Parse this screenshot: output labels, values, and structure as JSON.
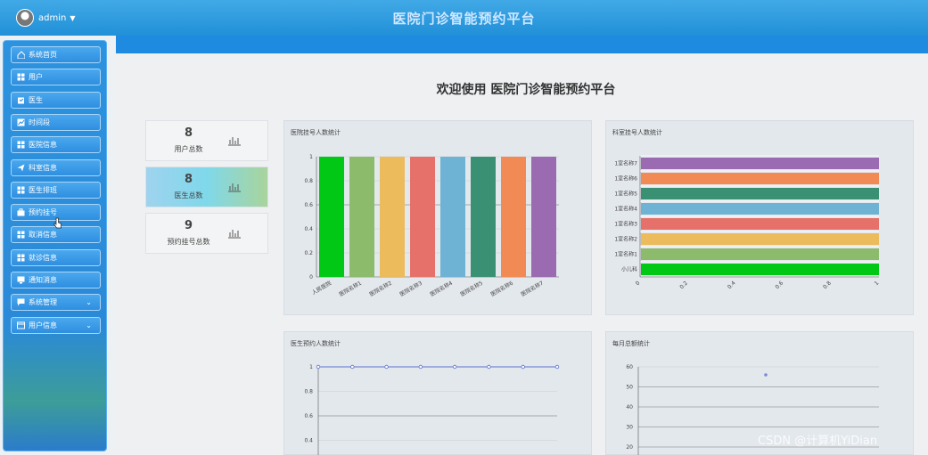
{
  "header": {
    "user": "admin",
    "title": "医院门诊智能预约平台"
  },
  "sidebar": {
    "items": [
      {
        "label": "系统首页",
        "icon": "home-icon"
      },
      {
        "label": "用户",
        "icon": "grid-icon"
      },
      {
        "label": "医生",
        "icon": "clipboard-icon"
      },
      {
        "label": "时间段",
        "icon": "chart-icon"
      },
      {
        "label": "医院信息",
        "icon": "grid-icon"
      },
      {
        "label": "科室信息",
        "icon": "send-icon"
      },
      {
        "label": "医生排班",
        "icon": "grid-icon"
      },
      {
        "label": "预约挂号",
        "icon": "briefcase-icon"
      },
      {
        "label": "取消信息",
        "icon": "grid-icon"
      },
      {
        "label": "就诊信息",
        "icon": "grid-icon"
      },
      {
        "label": "通知消息",
        "icon": "monitor-icon"
      },
      {
        "label": "系统管理",
        "icon": "chat-icon",
        "expandable": true
      },
      {
        "label": "用户信息",
        "icon": "card-icon",
        "expandable": true
      }
    ]
  },
  "main": {
    "welcome": "欢迎使用 医院门诊智能预约平台",
    "stats": [
      {
        "value": "8",
        "label": "用户总数"
      },
      {
        "value": "8",
        "label": "医生总数"
      },
      {
        "value": "9",
        "label": "预约挂号总数"
      }
    ]
  },
  "chart_data": [
    {
      "type": "bar",
      "title": "医院挂号人数统计",
      "categories": [
        "人民医院",
        "医院名称1",
        "医院名称2",
        "医院名称3",
        "医院名称4",
        "医院名称5",
        "医院名称6",
        "医院名称7"
      ],
      "values": [
        1,
        1,
        1,
        1,
        1,
        1,
        1,
        1
      ],
      "colors": [
        "#00c814",
        "#8cbb6c",
        "#ecbb5b",
        "#e6716a",
        "#6eb2d4",
        "#3a9073",
        "#f28a55",
        "#9a6bb1"
      ],
      "yticks": [
        "0",
        "0.2",
        "0.4",
        "0.6",
        "0.8",
        "1"
      ],
      "ylim": [
        0,
        1
      ]
    },
    {
      "type": "bar",
      "orientation": "horizontal",
      "title": "科室挂号人数统计",
      "categories": [
        "小儿科",
        "1室名称1",
        "1室名称2",
        "1室名称3",
        "1室名称4",
        "1室名称5",
        "1室名称6",
        "1室名称7"
      ],
      "values": [
        1,
        1,
        1,
        1,
        1,
        1,
        1,
        1
      ],
      "colors": [
        "#00c814",
        "#8cbb6c",
        "#ecbb5b",
        "#e6716a",
        "#6eb2d4",
        "#3a9073",
        "#f28a55",
        "#9a6bb1"
      ],
      "xticks": [
        "0",
        "0.2",
        "0.4",
        "0.6",
        "0.8",
        "1"
      ],
      "xlim": [
        0,
        1
      ]
    },
    {
      "type": "line",
      "title": "医生预约人数统计",
      "values": [
        1,
        1,
        1,
        1,
        1,
        1,
        1,
        1
      ],
      "yticks": [
        "0.4",
        "0.6",
        "0.8",
        "1"
      ],
      "ylim": [
        0,
        1
      ]
    },
    {
      "type": "scatter",
      "title": "每月总额统计",
      "points": [
        [
          1,
          56
        ]
      ],
      "yticks": [
        "20",
        "30",
        "40",
        "50",
        "60"
      ],
      "ylim": [
        0,
        60
      ]
    }
  ],
  "watermark": "CSDN @计算机YiDian"
}
